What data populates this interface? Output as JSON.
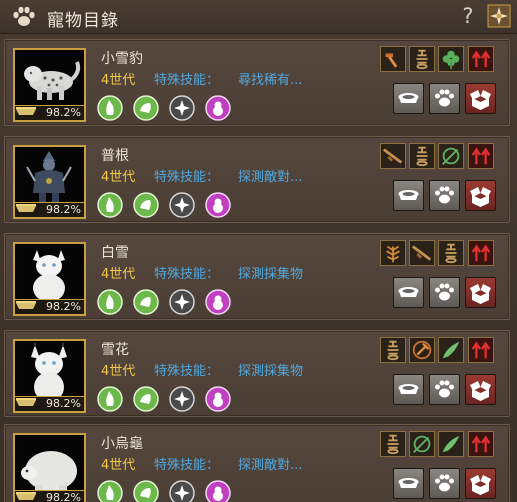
{
  "window": {
    "title": "寵物目錄",
    "help_label": "?"
  },
  "pets": [
    {
      "name": "小雪豹",
      "generation": "4世代",
      "skill_label": "特殊技能：",
      "skill": "尋找稀有...",
      "hunger": "98.2%",
      "animal": "snow-leopard"
    },
    {
      "name": "普根",
      "generation": "4世代",
      "skill_label": "特殊技能：",
      "skill": "探測敵對...",
      "hunger": "98.2%",
      "animal": "armored-goblin"
    },
    {
      "name": "白雪",
      "generation": "4世代",
      "skill_label": "特殊技能：",
      "skill": "探測採集物",
      "hunger": "98.2%",
      "animal": "white-cat"
    },
    {
      "name": "雪花",
      "generation": "4世代",
      "skill_label": "特殊技能：",
      "skill": "探測採集物",
      "hunger": "98.2%",
      "animal": "white-lynx"
    },
    {
      "name": "小烏龜",
      "generation": "4世代",
      "skill_label": "特殊技能：",
      "skill": "探測敵對...",
      "hunger": "98.2%",
      "animal": "white-turtle"
    }
  ],
  "colors": {
    "accent_gold": "#c8a040",
    "generation_text": "#f2c84a",
    "skill_text": "#4fa8e0",
    "trait_green": "#6db84a",
    "trait_pink": "#c040c0"
  }
}
